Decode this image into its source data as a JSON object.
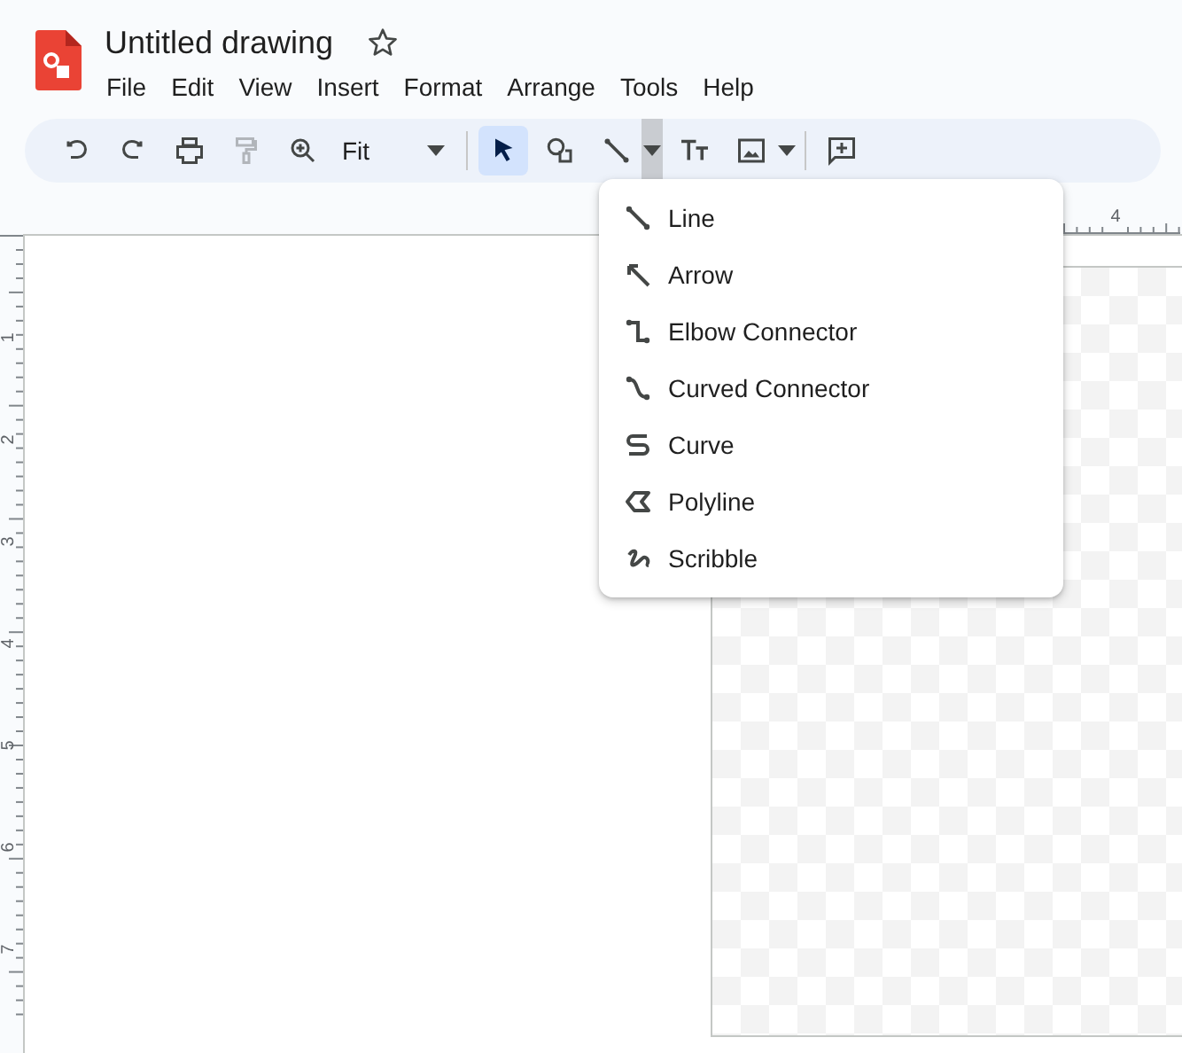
{
  "document": {
    "title": "Untitled drawing",
    "starred": false
  },
  "menu_bar": [
    "File",
    "Edit",
    "View",
    "Insert",
    "Format",
    "Arrange",
    "Tools",
    "Help"
  ],
  "toolbar": {
    "items": [
      {
        "kind": "undo",
        "disabled": false
      },
      {
        "kind": "redo",
        "disabled": false
      },
      {
        "kind": "print",
        "disabled": false
      },
      {
        "kind": "paint_format",
        "disabled": true
      },
      {
        "kind": "zoom",
        "disabled": false
      },
      {
        "kind": "zoom_field",
        "value": "Fit"
      },
      {
        "kind": "separator"
      },
      {
        "kind": "select",
        "selected": true
      },
      {
        "kind": "shape",
        "selected": false
      },
      {
        "kind": "line",
        "selected": false
      },
      {
        "kind": "dropdown",
        "expanded": true
      },
      {
        "kind": "text",
        "selected": false
      },
      {
        "kind": "image",
        "selected": false
      },
      {
        "kind": "dropdown",
        "expanded": false
      },
      {
        "kind": "separator"
      },
      {
        "kind": "comment",
        "selected": false
      }
    ]
  },
  "line_menu": [
    {
      "label": "Line",
      "kind": "line"
    },
    {
      "label": "Arrow",
      "kind": "arrow"
    },
    {
      "label": "Elbow Connector",
      "kind": "elbow"
    },
    {
      "label": "Curved Connector",
      "kind": "curved"
    },
    {
      "label": "Curve",
      "kind": "curve"
    },
    {
      "label": "Polyline",
      "kind": "polyline"
    },
    {
      "label": "Scribble",
      "kind": "scribble"
    }
  ],
  "top_ruler": [
    "4"
  ],
  "left_ruler": [
    "1",
    "2",
    "3",
    "4",
    "5",
    "6",
    "7"
  ]
}
